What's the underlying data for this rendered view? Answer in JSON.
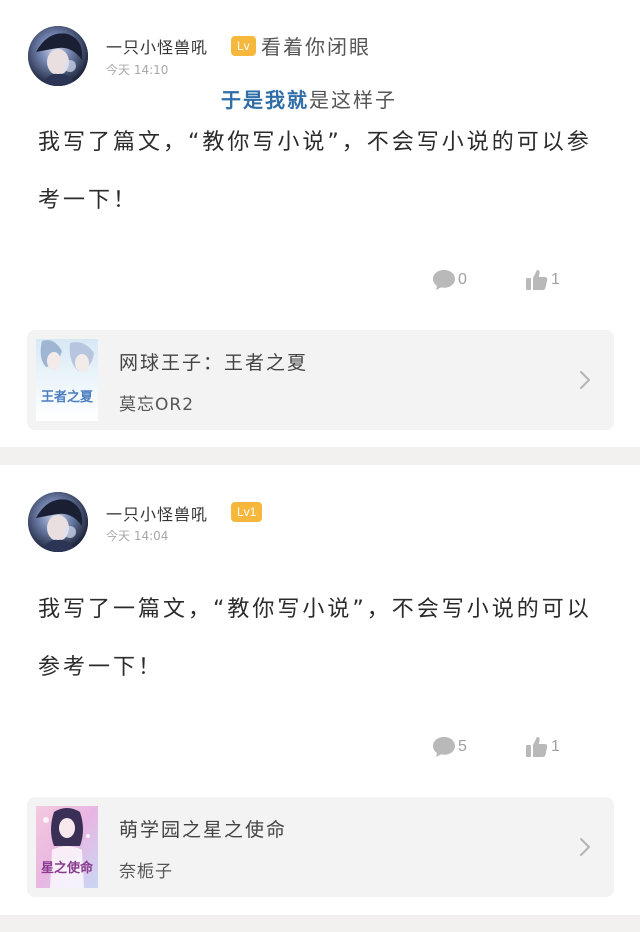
{
  "posts": [
    {
      "username": "一只小怪兽吼",
      "level": "Lv",
      "overlay_text": "看着你闭眼",
      "overlay_sub_highlight": "于是我就",
      "overlay_sub_rest": "是这样子",
      "timestamp": "今天 14:10",
      "content": "我写了篇文，“教你写小说”，不会写小说的可以参考一下！",
      "comments": "0",
      "likes": "1",
      "book": {
        "title": "网球王子：王者之夏",
        "author": "莫忘OR2",
        "cover_text": "王者之夏"
      }
    },
    {
      "username": "一只小怪兽吼",
      "level": "Lv1",
      "timestamp": "今天 14:04",
      "content": "我写了一篇文，“教你写小说”，不会写小说的可以参考一下！",
      "comments": "5",
      "likes": "1",
      "book": {
        "title": "萌学园之星之使命",
        "author": "奈栀子",
        "cover_text": "星之使命"
      }
    }
  ],
  "icons": {
    "comment": "comment-bubble-icon",
    "like": "thumbs-up-icon",
    "chevron": "chevron-right-icon"
  },
  "colors": {
    "level_badge": "#f6b83c",
    "divider": "#f2f1ef",
    "card_bg": "#f3f3f3",
    "icon_gray": "#b9b9b9",
    "highlight_blue": "#2f6ea7"
  }
}
